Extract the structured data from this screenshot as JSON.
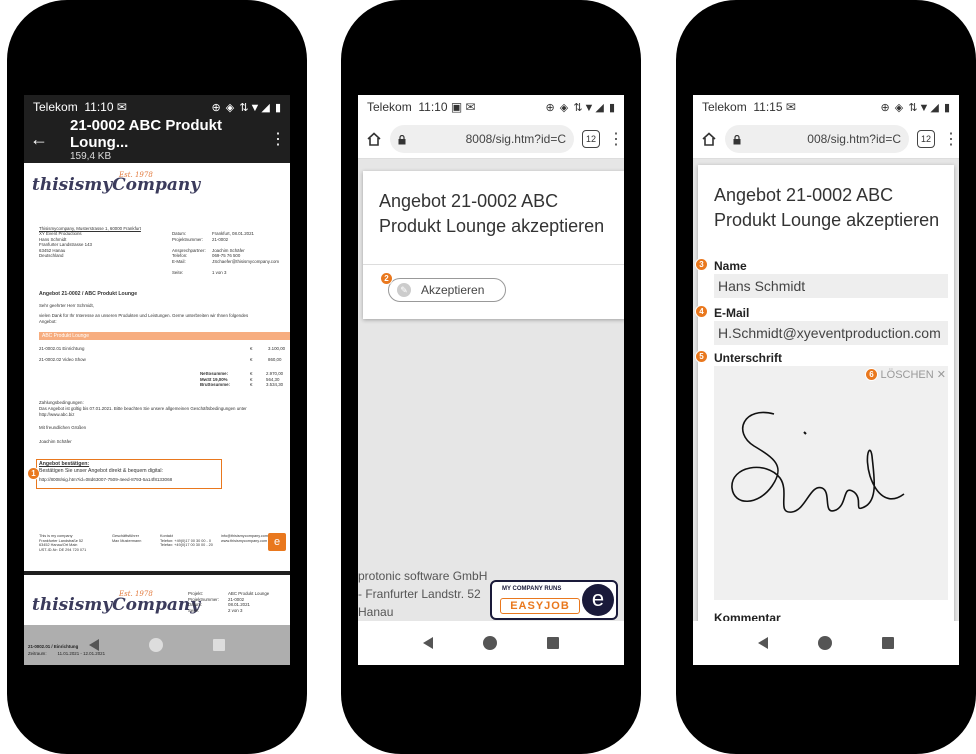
{
  "phone1": {
    "status": {
      "carrier": "Telekom",
      "time": "11:10"
    },
    "appbar": {
      "title": "21-0002 ABC Produkt Loung...",
      "subtitle": "159,4 KB"
    },
    "document": {
      "logo": "thisismyCompany",
      "logo_est": "Est. 1978",
      "sender_line": "Thisismycompany, Musterstrasse 1, 60000 Frankfurt",
      "recipient": "XY Event Productions\nHans Schmidt\nFranfurter Landstrasse 143\n63452 Hanau\nDeutschland",
      "meta_labels": "Datum:\nProjektnummer:\n\nAnsprechpartner:\nTelefon:\nE-Mail:\n\nSeite:",
      "meta_values": "Frankfurt, 08.01.2021\n21-0002\n\nJoachim Schäfer\n069-75 76 500\nJSchaefer@thisismycompany.com\n\n1 von 3",
      "subject": "Angebot 21-0002 / ABC Produkt Lounge",
      "salutation": "Sehr geehrter Herr Schmidt,",
      "intro": "vielen Dank für Ihr Interesse an unseren Produkten und Leistungen. Gerne unterbreiten wir Ihnen folgendes\nAngebot:",
      "section_bar": "ABC Produkt Lounge",
      "line1": "21-0002.01 Einrichtung",
      "line1_cur": "€",
      "line1_val": "3.100,00",
      "line2": "21-0002.02 Video Show",
      "line2_cur": "€",
      "line2_val": "860,00",
      "totals_labels": "Nettosumme:\nMwSt 19,00%\nBruttosumme:",
      "totals_cur": "€\n€\n€",
      "totals_values": "2.970,00\n564,30\n3.534,30",
      "terms_title": "Zahlungsbedingungen:",
      "terms": "Das Angebot ist gültig bis 07.01.2021. Bitte beachten Sie unsere allgemeinen Geschäftsbedingungen unter\nhttp://www.abc.biz",
      "closing": "Mit freundlichen Grüßen",
      "signer": "Joachim Schäfer",
      "confirm_title": "Angebot bestätigen:",
      "confirm_text": "Bestätigen Sie unser Angebot direkt & bequem digital:",
      "confirm_link": "http://8008/sig.htm?id=08d63007-7509-4eed-8793-5a14f8133068",
      "footer_col1": "This is my company\nFrankfurter Landstraße 52\n63452 Hanau/Ort Main\nUST-ID-Nr: DE 294 720 071",
      "footer_col2": "Geschäftsführer\nMax Mustermann",
      "footer_col3": "Kontakt\nTelefon: +49(0)17 00 30 00 - 0\nTelefax: +49(0)17 00 30 00 - 20",
      "footer_col4": "info@thisismycompany.com\nwww.thisismycompany.com",
      "badge": "1"
    },
    "page2": {
      "logo": "thisismyCompany",
      "logo_est": "Est. 1978",
      "meta_labels": "Projekt:\nProjektnummer:\nDatum:\nSeite:",
      "meta_values": "ABC Produkt Lounge\n21-0002\n08.01.2021\n2 von 3",
      "item": "21-0002.01 / Einrichtung",
      "item_sub": "Zeitraum:         11.01.2021 - 12.01.2021"
    }
  },
  "phone2": {
    "status": {
      "carrier": "Telekom",
      "time": "11:10"
    },
    "url": "8008/sig.htm?id=C",
    "tabs": "12",
    "card_title": "Angebot 21-0002 ABC Produkt Lounge akzeptieren",
    "accept_label": "Akzeptieren",
    "badge": "2",
    "footer": "protonic software GmbH\n- Franfurter Landstr. 52\nHanau",
    "easyjob_top": "MY COMPANY RUNS",
    "easyjob_name": "EASYJOB",
    "easyjob_e": "e"
  },
  "phone3": {
    "status": {
      "carrier": "Telekom",
      "time": "11:15"
    },
    "url": "008/sig.htm?id=C",
    "tabs": "12",
    "card_title": "Angebot 21-0002 ABC Produkt Lounge akzeptieren",
    "name_label": "Name",
    "name_value": "Hans Schmidt",
    "email_label": "E-Mail",
    "email_value": "H.Schmidt@xyeventproduction.com",
    "signature_label": "Unterschrift",
    "clear_label": "LÖSCHEN",
    "comment_label": "Kommentar",
    "badge_name": "3",
    "badge_email": "4",
    "badge_signature": "5",
    "badge_clear": "6"
  }
}
